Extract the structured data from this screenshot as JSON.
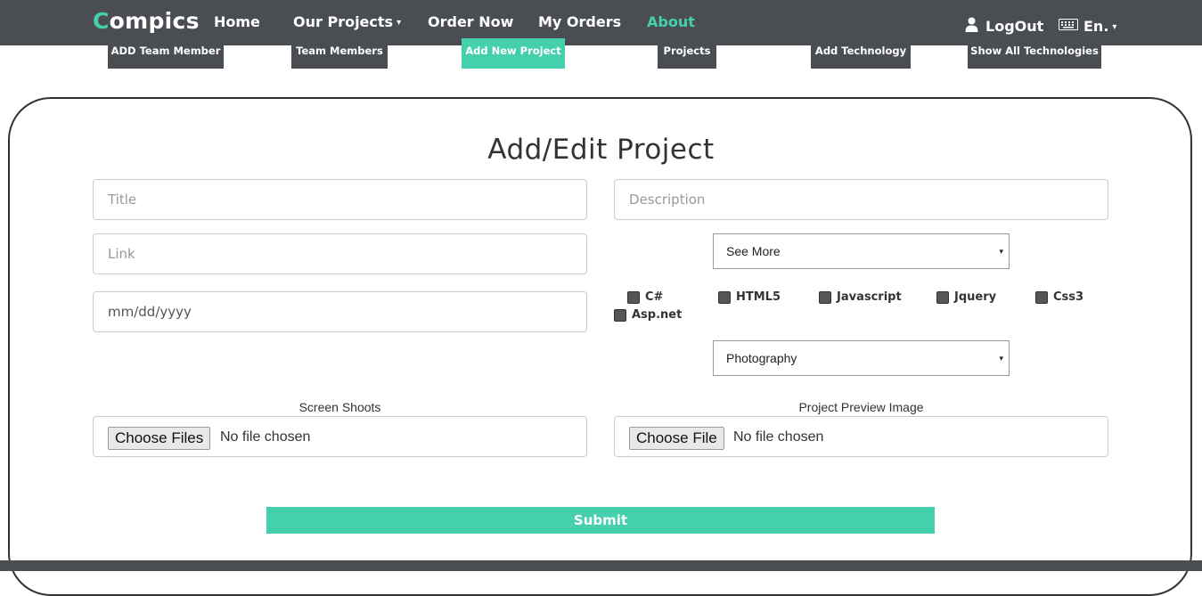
{
  "navbar": {
    "brand_accent": "C",
    "brand_rest": "ompics",
    "home": "Home",
    "our_projects": "Our Projects",
    "our_projects_caret": "▾",
    "order_now": "Order Now",
    "my_orders": "My Orders",
    "about": "About",
    "logout": "LogOut",
    "language": "En.",
    "language_caret": "▾"
  },
  "subnav": {
    "add_team_member": "ADD Team Member",
    "team_members": "Team Members",
    "add_new_project": "Add New Project",
    "projects": "Projects",
    "add_technology": "Add Technology",
    "show_all_technologies": "Show All Technologies"
  },
  "form": {
    "title": "Add/Edit Project",
    "title_placeholder": "Title",
    "description_placeholder": "Description",
    "link_placeholder": "Link",
    "date_placeholder": "mm/dd/yyyy",
    "see_more_select": "See More",
    "category_select": "Photography",
    "technologies": [
      "C#",
      "HTML5",
      "Javascript",
      "Jquery",
      "Css3",
      "Asp.net"
    ],
    "screen_shoots_label": "Screen Shoots",
    "preview_label": "Project Preview Image",
    "choose_files": "Choose Files",
    "choose_file": "Choose File",
    "no_file": "No file chosen",
    "submit": "Submit"
  },
  "colors": {
    "accent": "#45d0ad",
    "nav_bg": "#4a4e53"
  },
  "icons": {
    "user": "user-icon",
    "keyboard": "keyboard-icon",
    "select_arrow": "▾"
  }
}
